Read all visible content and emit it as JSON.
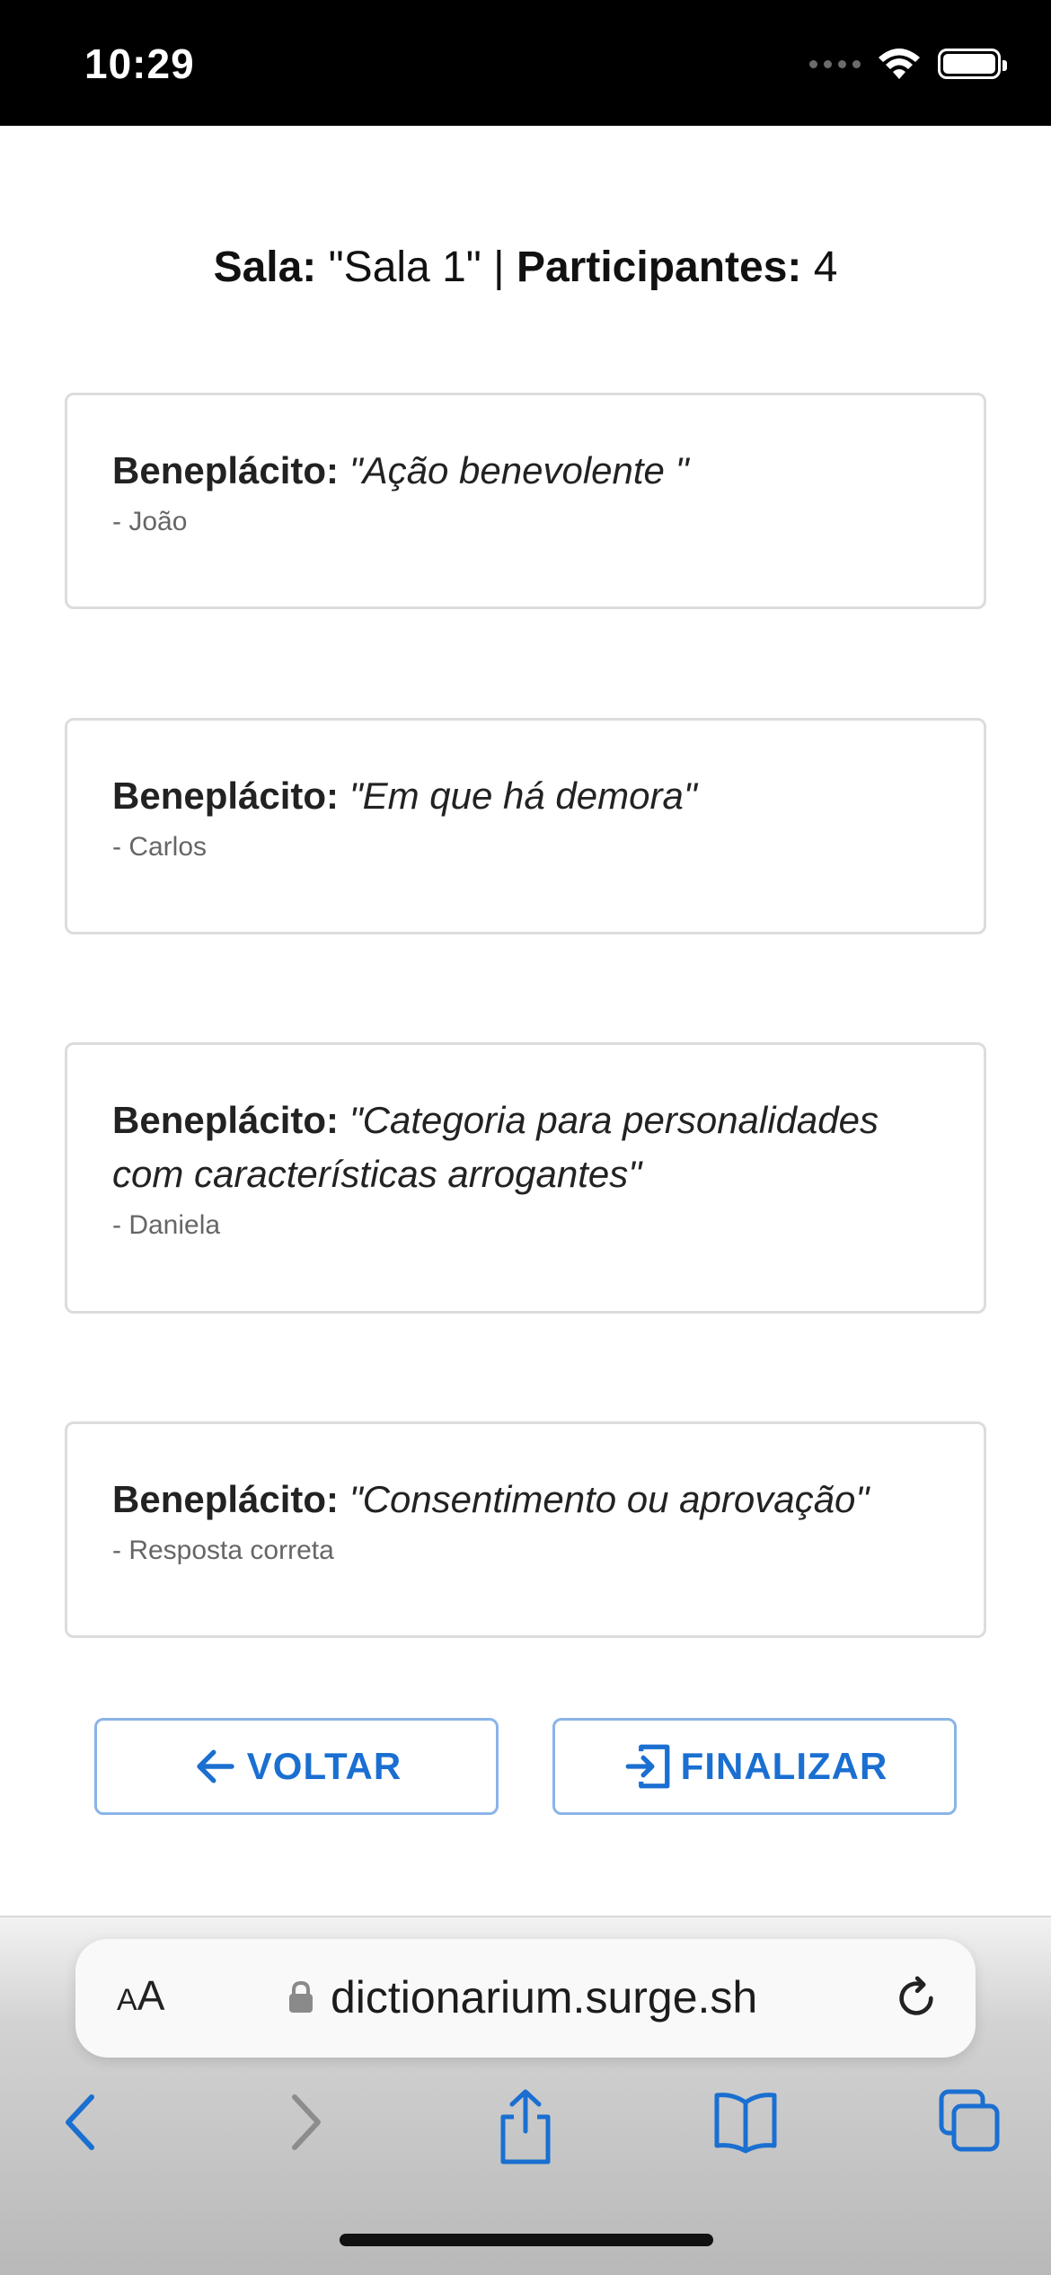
{
  "status_bar": {
    "time": "10:29"
  },
  "header": {
    "room_label": "Sala:",
    "room_value": " \"Sala 1\" | ",
    "participants_label": "Participantes:",
    "participants_value": " 4"
  },
  "cards": [
    {
      "word": "Beneplácito:",
      "definition": "\"Ação benevolente \"",
      "author": "- João"
    },
    {
      "word": "Beneplácito:",
      "definition": "\"Em que há demora\"",
      "author": "- Carlos"
    },
    {
      "word": "Beneplácito:",
      "definition": "\"Categoria para personalidades com características arrogantes\"",
      "author": "- Daniela"
    },
    {
      "word": "Beneplácito:",
      "definition": "\"Consentimento ou aprovação\"",
      "author": "- Resposta correta"
    }
  ],
  "buttons": {
    "back_label": "VOLTAR",
    "finish_label": "FINALIZAR"
  },
  "browser": {
    "text_size_small": "A",
    "text_size_large": "A",
    "url": "dictionarium.surge.sh"
  },
  "colors": {
    "accent": "#1a6fd1",
    "button_border": "#8ab4e8",
    "card_border": "#dcdcdc"
  }
}
